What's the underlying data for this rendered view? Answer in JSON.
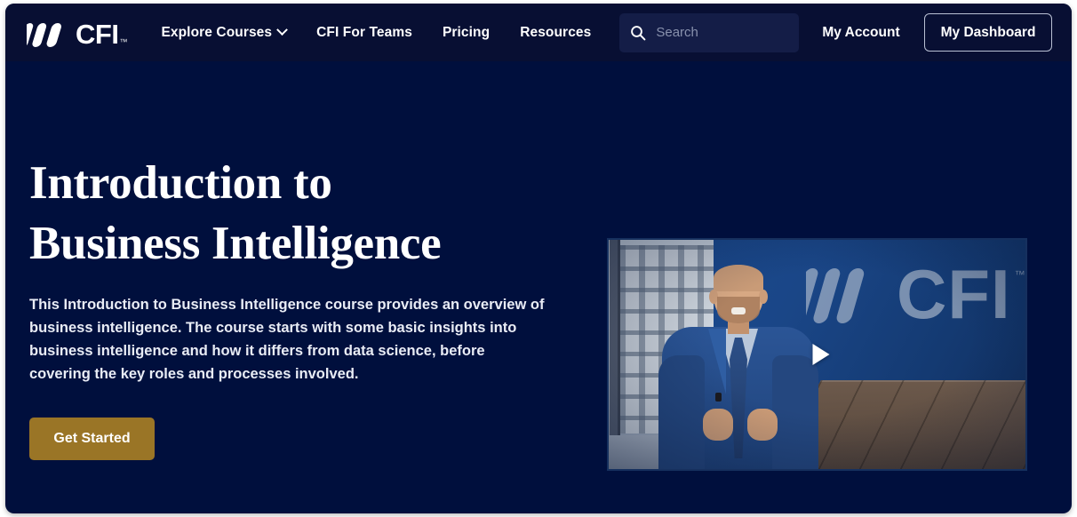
{
  "nav": {
    "logo": {
      "text": "CFI",
      "tm": "™",
      "icon": "cfi-logo-icon"
    },
    "links": [
      {
        "label": "Explore Courses",
        "has_chevron": true
      },
      {
        "label": "CFI For Teams",
        "has_chevron": false
      },
      {
        "label": "Pricing",
        "has_chevron": false
      },
      {
        "label": "Resources",
        "has_chevron": false
      }
    ],
    "search": {
      "placeholder": "Search",
      "value": "",
      "icon": "search-icon"
    },
    "account_label": "My Account",
    "dashboard_label": "My Dashboard"
  },
  "hero": {
    "title_line1": "Introduction to",
    "title_line2": "Business Intelligence",
    "description": "This Introduction to Business Intelligence course provides an overview of business intelligence. The course starts with some basic insights into business intelligence and how it differs from data science, before covering the key roles and processes involved.",
    "cta_label": "Get Started"
  },
  "video": {
    "play_icon": "play-icon",
    "wall_logo_text": "CFI",
    "wall_logo_tm": "™"
  },
  "colors": {
    "page_background": "#000f3d",
    "nav_background": "#080f33",
    "cta_gold": "#9a7526",
    "text_white": "#ffffff",
    "search_field": "#141d47",
    "search_placeholder": "#8891ad",
    "dashboard_border": "#b9c0d4"
  }
}
